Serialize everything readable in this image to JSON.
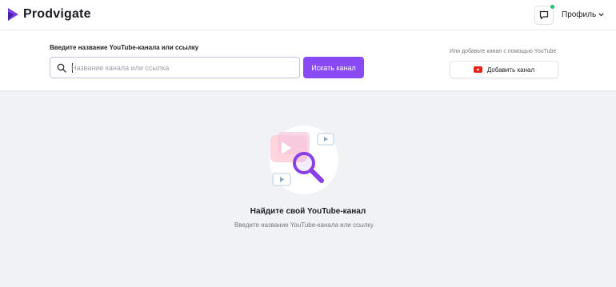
{
  "brand": {
    "name": "Prodvigate",
    "color": "#7b3fe4"
  },
  "header": {
    "chat_icon": "chat-bubble-icon",
    "notification_color": "#24c26b",
    "profile_label": "Профиль"
  },
  "search": {
    "title": "Введите название YouTube-канала или ссылку",
    "placeholder": "Название канала или ссылка",
    "value": "",
    "button_label": "Искать канал",
    "button_color": "#8a4af3"
  },
  "youtube": {
    "hint": "Или добавьте канал с помощью YouTube",
    "button_label": "Добавить канал",
    "icon": "youtube-icon",
    "icon_color": "#e62117"
  },
  "empty_state": {
    "illustration": "youtube-search-illustration",
    "title": "Найдите свой YouTube-канал",
    "subtitle": "Введите название YouTube-канала или ссылку"
  }
}
